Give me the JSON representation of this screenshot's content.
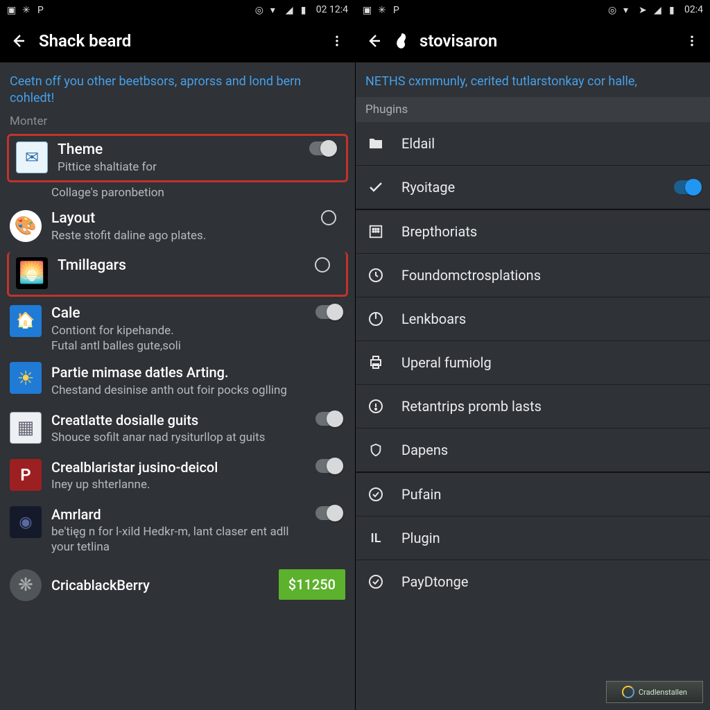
{
  "left": {
    "status": {
      "time": "02 12:4"
    },
    "appbar": {
      "title": "Shack beard"
    },
    "intro": "Ceetn off you other beetbsors, aprorss and lond bern cohledt!",
    "section": "Monter",
    "items": [
      {
        "title": "Theme",
        "sub": "Pittice shaltiate for",
        "sub2": "Collage's paronbetion",
        "icon": "envelope-icon",
        "control": "toggle-off",
        "highlight": true
      },
      {
        "title": "Layout",
        "sub": "Reste stofit daline ago plates.",
        "icon": "palette-icon",
        "control": "radio"
      },
      {
        "title": "Tmillagars",
        "icon": "sunrise-icon",
        "control": "radio",
        "highlight": true
      },
      {
        "title": "Cale",
        "sub": "Contiont for kipehande.\nFutal antl balles gute,soli",
        "icon": "calendar-icon",
        "control": "toggle-off"
      },
      {
        "title": "Partie mimase datles Arting.",
        "sub": "Chestand desinise anth out foir pocks oglling",
        "icon": "weather-icon"
      },
      {
        "title": "Creatlatte dosialle guits",
        "sub": "Shouce sofilt anar nad rysiturllop at guits",
        "icon": "screenshot-icon",
        "control": "toggle-off"
      },
      {
        "title": "Crealblaristar jusino-deicol",
        "sub": "Iney up shterlanne.",
        "icon": "red-app-icon",
        "control": "toggle-off"
      },
      {
        "title": "Amrlard",
        "sub": "be'tięg n for l-xild Hedkr-m, lant claser ent adll your tetlina",
        "icon": "dark-app-icon",
        "control": "toggle-off"
      },
      {
        "title": "CricablackBerry",
        "icon": "coin-icon",
        "price": "$11250"
      }
    ]
  },
  "right": {
    "status": {
      "time": "02:4"
    },
    "appbar": {
      "title": "stovisaron"
    },
    "intro": "NETHS cxmmunly, cerited tutlarstonkay cor halle,",
    "section": "Phugins",
    "items": [
      {
        "label": "Eldail",
        "icon": "folder-icon"
      },
      {
        "label": "Ryoitage",
        "icon": "check-icon",
        "control": "toggle-on",
        "divider": true
      },
      {
        "label": "Brepthoriats",
        "icon": "grid-icon"
      },
      {
        "label": "Foundomctrosplations",
        "icon": "clock-icon"
      },
      {
        "label": "Lenkboars",
        "icon": "power-icon"
      },
      {
        "label": "Uperal fumiolg",
        "icon": "print-icon"
      },
      {
        "label": "Retantrips promb lasts",
        "icon": "alert-clock-icon"
      },
      {
        "label": "Dapens",
        "icon": "shield-icon",
        "divider": true
      },
      {
        "label": "Pufain",
        "icon": "circle-check-icon"
      },
      {
        "label": "Plugin",
        "icon": "letters-icon"
      },
      {
        "label": "PayDtonge",
        "icon": "circle-check-icon"
      }
    ],
    "watermark": "Cradlenstallen"
  }
}
